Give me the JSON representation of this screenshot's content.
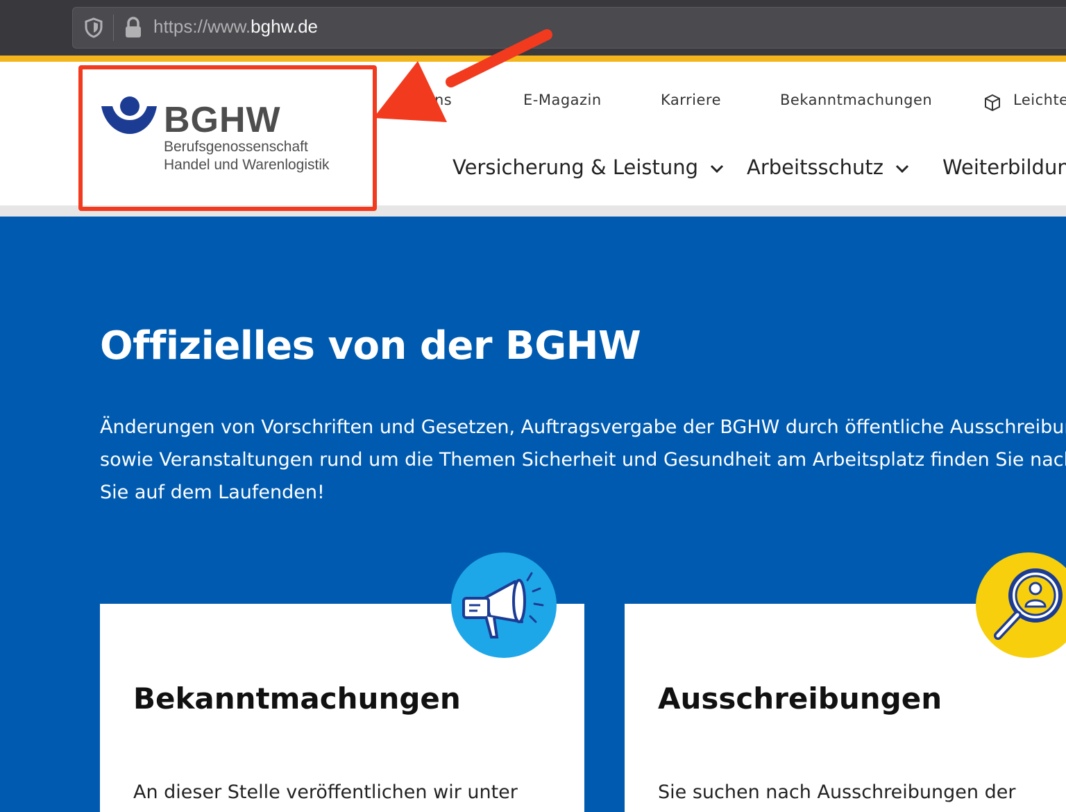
{
  "browser": {
    "url_prefix": "https://www.",
    "url_domain": "bghw.de"
  },
  "logo": {
    "name": "BGHW",
    "line1": "Berufsgenossenschaft",
    "line2": "Handel und Warenlogistik"
  },
  "top_nav": {
    "partial": "ns",
    "items": [
      "E-Magazin",
      "Karriere",
      "Bekanntmachungen",
      "Leichte"
    ]
  },
  "main_nav": {
    "items": [
      "Versicherung & Leistung",
      "Arbeitsschutz",
      "Weiterbildung"
    ]
  },
  "hero": {
    "title": "Offizielles von der BGHW",
    "line1": "Änderungen von Vorschriften und Gesetzen, Auftragsvergabe der BGHW durch öffentliche Ausschreibung",
    "line2": "sowie Veranstaltungen rund um die Themen Sicherheit und Gesundheit am Arbeitsplatz finden Sie nachf",
    "line3": "Sie auf dem Laufenden!"
  },
  "cards": [
    {
      "title": "Bekanntmachungen",
      "text": "An dieser Stelle veröffentlichen wir unter",
      "icon": "megaphone-icon"
    },
    {
      "title": "Ausschreibungen",
      "text": "Sie suchen nach Ausschreibungen der",
      "icon": "magnifier-person-icon"
    }
  ],
  "colors": {
    "brand_blue": "#005bb0",
    "accent_yellow": "#f3b51b",
    "annotation_red": "#f23a1f",
    "badge_cyan": "#1ea7e8",
    "badge_yellow": "#f8cf0c"
  }
}
